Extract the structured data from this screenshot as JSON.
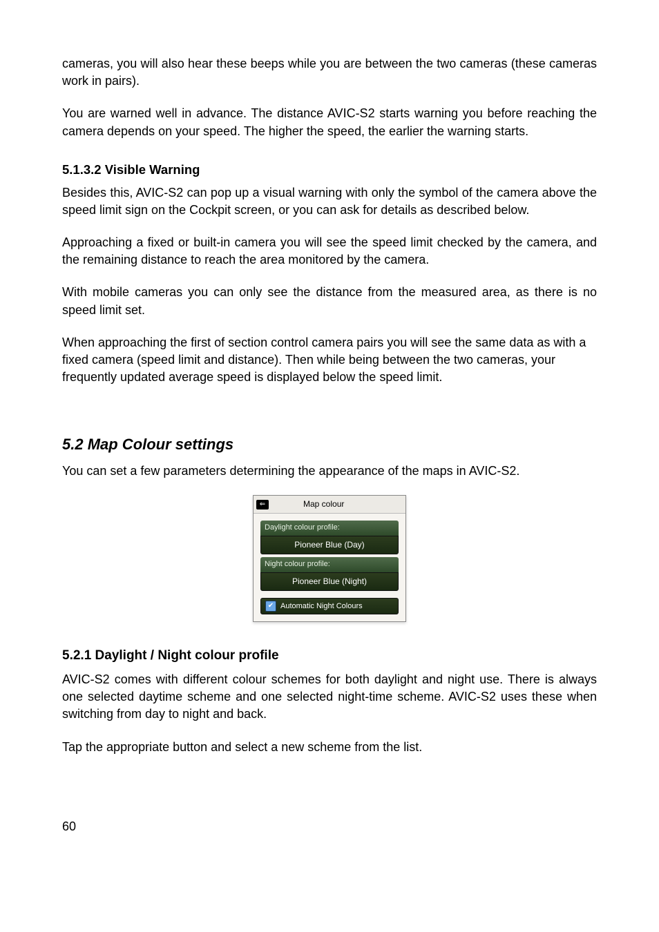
{
  "p1": "cameras, you will also hear these beeps while you are between the two cameras (these cameras work in pairs).",
  "p2": "You are warned well in advance. The distance AVIC-S2 starts warning you before reaching the camera depends on your speed. The higher the speed, the earlier the warning starts.",
  "h_5132": "5.1.3.2  Visible Warning",
  "p3": "Besides this, AVIC-S2 can pop up a visual warning with only the symbol of the camera above the speed limit sign on the Cockpit screen, or you can ask for details as described below.",
  "p4": "Approaching a fixed or built-in camera you will see the speed limit checked by the camera, and the remaining distance to reach the area monitored by the camera.",
  "p5": "With mobile cameras you can only see the distance from the measured area, as there is no speed limit set.",
  "p6": "When approaching the first of section control camera pairs you will see the same data as with a fixed camera (speed limit and distance). Then while being between the two cameras, your frequently updated average speed is displayed below the speed limit.",
  "h_52": "5.2  Map Colour settings",
  "p7": "You can set a few parameters determining the appearance of the maps in AVIC-S2.",
  "screenshot": {
    "title": "Map colour",
    "day_label": "Daylight colour profile:",
    "day_value": "Pioneer Blue (Day)",
    "night_label": "Night colour profile:",
    "night_value": "Pioneer Blue (Night)",
    "auto_label": "Automatic Night Colours"
  },
  "h_521": "5.2.1  Daylight / Night colour profile",
  "p8": "AVIC-S2 comes with different colour schemes for both daylight and night use. There is always one selected daytime scheme and one selected night-time scheme. AVIC-S2 uses these when switching from day to night and back.",
  "p9": "Tap the appropriate button and select a new scheme from the list.",
  "page_number": "60"
}
